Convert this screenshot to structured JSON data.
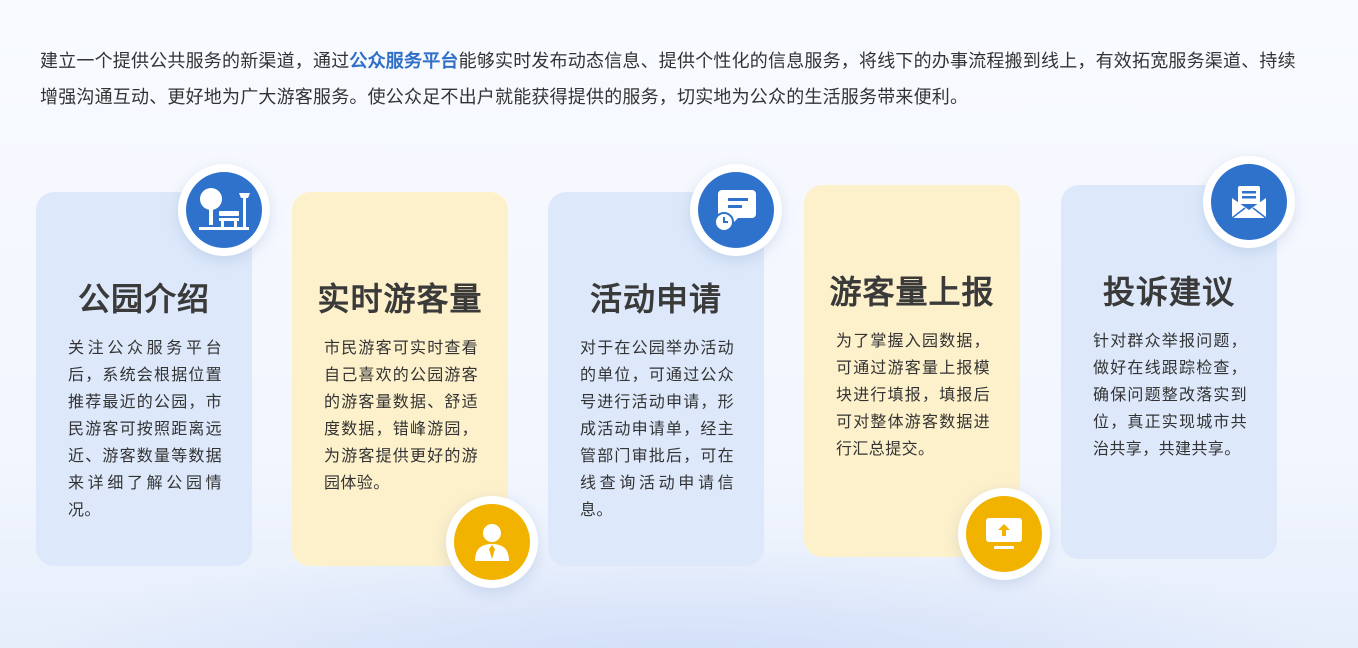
{
  "intro": {
    "before": "建立一个提供公共服务的新渠道，通过",
    "highlight": "公众服务平台",
    "after": "能够实时发布动态信息、提供个性化的信息服务，将线下的办事流程搬到线上，有效拓宽服务渠道、持续增强沟通互动、更好地为广大游客服务。使公众足不出户就能获得提供的服务，切实地为公众的生活服务带来便利。"
  },
  "colors": {
    "blue_card": "#dde9fb",
    "yellow_card": "#fdf1cb",
    "blue_icon": "#2f72cc",
    "gold_icon": "#f2b300",
    "highlight": "#2f6fc7"
  },
  "cards": [
    {
      "title": "公园介绍",
      "desc": "关注公众服务平台后，系统会根据位置推荐最近的公园，市民游客可按照距离远近、游客数量等数据来详细了解公园情况。",
      "icon": "park-bench-icon"
    },
    {
      "title": "实时游客量",
      "desc": "市民游客可实时查看自己喜欢的公园游客的游客量数据、舒适度数据，错峰游园，为游客提供更好的游园体验。",
      "icon": "user-person-icon"
    },
    {
      "title": "活动申请",
      "desc": "对于在公园举办活动的单位，可通过公众号进行活动申请，形成活动申请单，经主管部门审批后，可在线查询活动申请信息。",
      "icon": "chat-clock-icon"
    },
    {
      "title": "游客量上报",
      "desc": "为了掌握入园数据，可通过游客量上报模块进行填报，填报后可对整体游客数据进行汇总提交。",
      "icon": "upload-monitor-icon"
    },
    {
      "title": "投诉建议",
      "desc": "针对群众举报问题，做好在线跟踪检查，确保问题整改落实到位，真正实现城市共治共享，共建共享。",
      "icon": "mail-envelope-icon"
    }
  ]
}
